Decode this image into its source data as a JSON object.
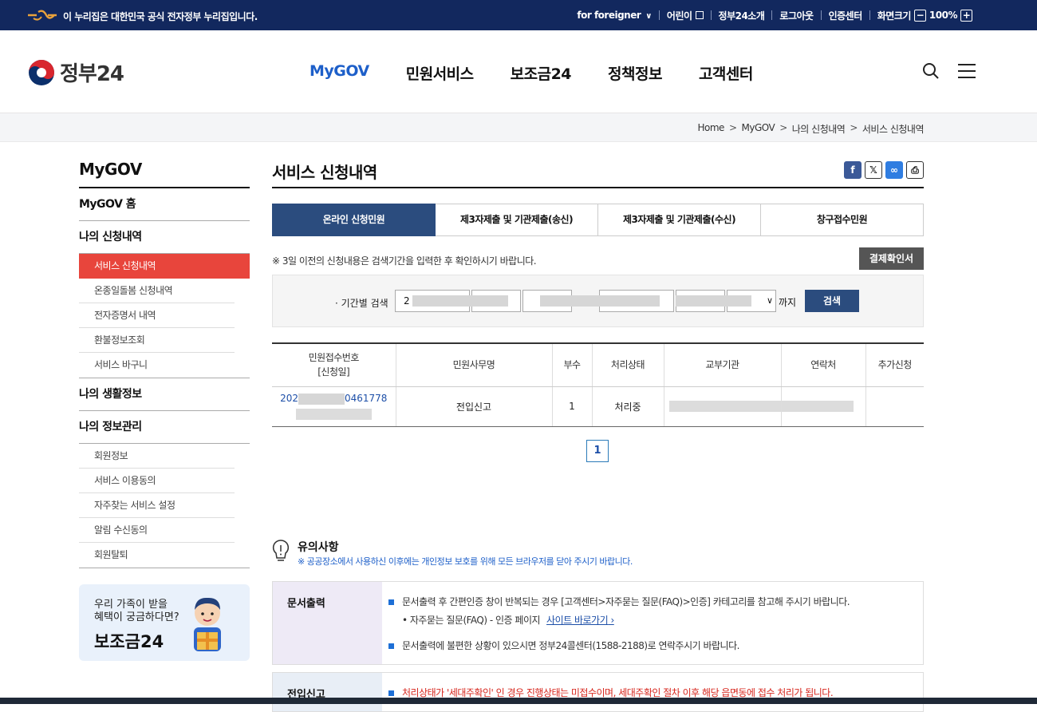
{
  "govbar": {
    "official_text": "이 누리집은 대한민국 공식 전자정부 누리집입니다.",
    "for_foreigner": "for foreigner",
    "kids": "어린이",
    "about": "정부24소개",
    "logout": "로그아웃",
    "cert": "인증센터",
    "font_size_label": "화면크기",
    "zoom": "100%",
    "zoom_out": "−",
    "zoom_in": "+"
  },
  "header": {
    "logo": "정부24",
    "gnb": [
      "MyGOV",
      "민원서비스",
      "보조금24",
      "정책정보",
      "고객센터"
    ]
  },
  "breadcrumb": [
    "Home",
    "MyGOV",
    "나의 신청내역",
    "서비스 신청내역"
  ],
  "side": {
    "title": "MyGOV",
    "home": "MyGOV 홈",
    "apply_history": "나의 신청내역",
    "apply_items": [
      "서비스 신청내역",
      "온종일돌봄 신청내역",
      "전자증명서 내역",
      "환불정보조회",
      "서비스 바구니"
    ],
    "life_info": "나의 생활정보",
    "info_manage": "나의 정보관리",
    "manage_items": [
      "회원정보",
      "서비스 이용동의",
      "자주찾는 서비스 설정",
      "알림 수신동의",
      "회원탈퇴"
    ],
    "banner_line1": "우리 가족이 받을",
    "banner_line2": "혜택이 궁금하다면?",
    "banner_title": "보조금24"
  },
  "main": {
    "title": "서비스 신청내역",
    "tabs": [
      "온라인 신청민원",
      "제3자제출 및 기관제출(송신)",
      "제3자제출 및 기관제출(수신)",
      "창구접수민원"
    ],
    "notice": "※ 3일 이전의 신청내용은 검색기간을 입력한 후 확인하시기 바랍니다.",
    "pay_button": "결제확인서",
    "search_label": "· 기간별 검색",
    "start_year_value": "2",
    "until": "까지",
    "search_button": "검색",
    "table": {
      "headers": [
        "민원접수번호\n[신청일]",
        "민원사무명",
        "부수",
        "처리상태",
        "교부기관",
        "연락처",
        "추가신청"
      ],
      "rows": [
        {
          "rcpt_prefix": "202",
          "rcpt_suffix": "0461778",
          "name": "전입신고",
          "count": "1",
          "status": "처리중"
        }
      ]
    },
    "page": "1",
    "caution_title": "유의사항",
    "caution_desc": "※ 공공장소에서 사용하신 이후에는 개인정보 보호를 위해 모든 브라우저를 닫아 주시기 바랍니다.",
    "doc_print": {
      "label": "문서출력",
      "line1": "문서출력 후 간편인증 창이 반복되는 경우 [고객센터>자주묻는 질문(FAQ)>인증] 카테고리를 참고해 주시기 바랍니다.",
      "line2": "• 자주묻는 질문(FAQ) - 인증 페이지",
      "link": "사이트 바로가기",
      "line3": "문서출력에 불편한 상황이 있으시면 정부24콜센터(1588-2188)로 연락주시기 바랍니다."
    },
    "move_in": {
      "label": "전입신고",
      "line1": "처리상태가 '세대주확인' 인 경우 진행상태는 미접수이며, 세대주확인 절차 이후 해당 읍면동에 접수 처리가 됩니다."
    }
  }
}
